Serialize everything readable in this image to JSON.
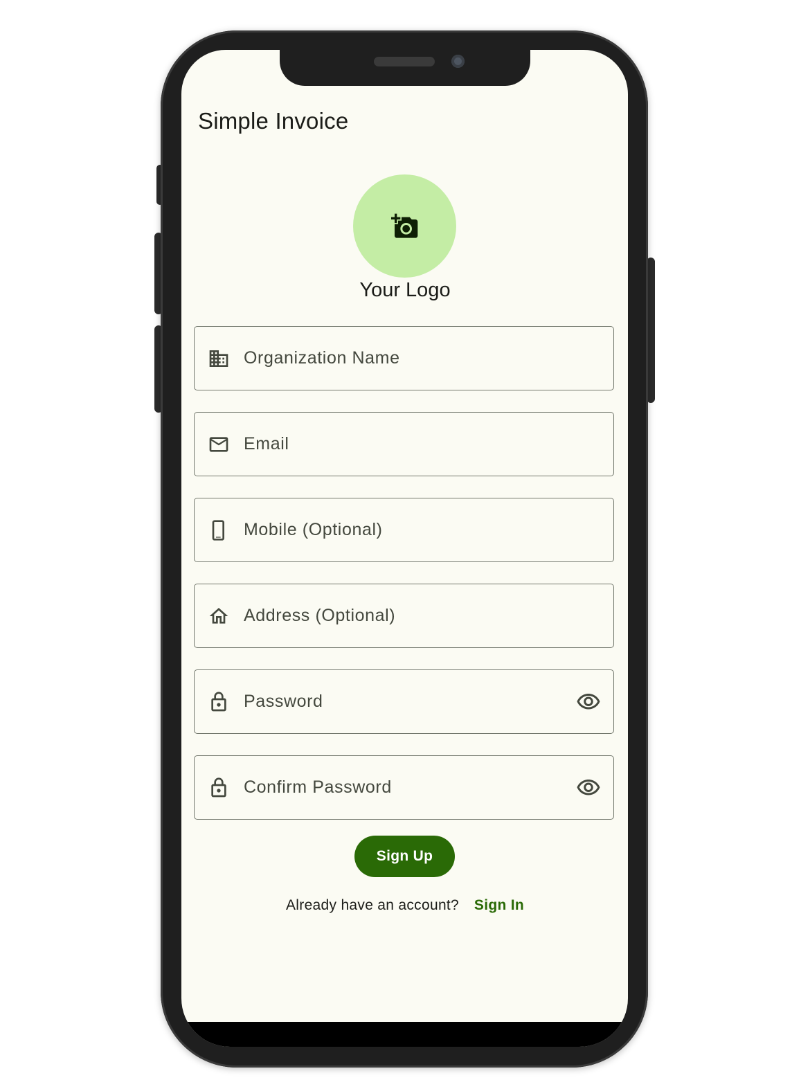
{
  "app": {
    "title": "Simple Invoice"
  },
  "logo": {
    "label": "Your Logo",
    "icon": "add-a-photo-icon",
    "background_color": "#c4eda5"
  },
  "form": {
    "fields": [
      {
        "name": "organization-name-field",
        "placeholder": "Organization Name",
        "value": "",
        "icon": "business-icon"
      },
      {
        "name": "email-field",
        "placeholder": "Email",
        "value": "",
        "icon": "mail-icon"
      },
      {
        "name": "mobile-field",
        "placeholder": "Mobile (Optional)",
        "value": "",
        "icon": "smartphone-icon"
      },
      {
        "name": "address-field",
        "placeholder": "Address (Optional)",
        "value": "",
        "icon": "home-icon"
      },
      {
        "name": "password-field",
        "placeholder": "Password",
        "value": "",
        "icon": "lock-icon",
        "trailing_icon": "visibility-icon"
      },
      {
        "name": "confirm-password-field",
        "placeholder": "Confirm Password",
        "value": "",
        "icon": "lock-icon",
        "trailing_icon": "visibility-icon"
      }
    ]
  },
  "actions": {
    "signup_label": "Sign Up",
    "signin_prompt": "Already have an account?",
    "signin_label": "Sign In"
  },
  "colors": {
    "primary": "#2a6a06",
    "surface": "#fbfbf3",
    "outline": "#73786d",
    "on_surface": "#1b1c18"
  }
}
